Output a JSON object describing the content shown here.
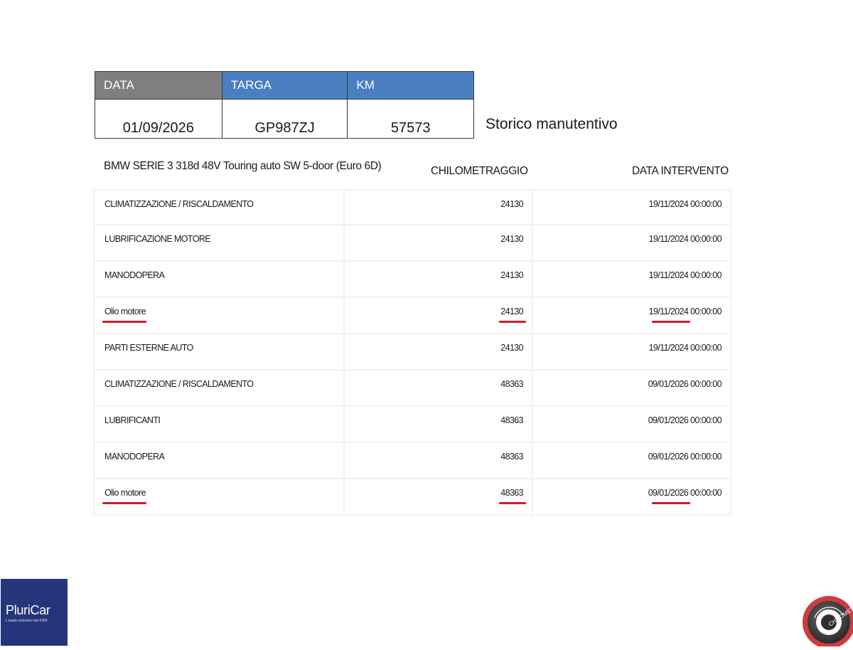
{
  "summary": {
    "headers": [
      "DATA",
      "TARGA",
      "KM"
    ],
    "values": [
      "01/09/2026",
      "GP987ZJ",
      "57573"
    ]
  },
  "document_title": "Storico manutentivo",
  "vehicle": "BMW SERIE 3 318d 48V Touring auto SW 5-door (Euro 6D)",
  "columns": {
    "km": "CHILOMETRAGGIO",
    "date": "DATA INTERVENTO"
  },
  "rows": [
    {
      "desc": "CLIMATIZZAZIONE / RISCALDAMENTO",
      "km": "24130",
      "date": "19/11/2024 00:00:00",
      "highlighted": false
    },
    {
      "desc": "LUBRIFICAZIONE MOTORE",
      "km": "24130",
      "date": "19/11/2024 00:00:00",
      "highlighted": false
    },
    {
      "desc": "MANODOPERA",
      "km": "24130",
      "date": "19/11/2024 00:00:00",
      "highlighted": false
    },
    {
      "desc": "Olio motore",
      "km": "24130",
      "date": "19/11/2024 00:00:00",
      "highlighted": true
    },
    {
      "desc": "PARTI ESTERNE AUTO",
      "km": "24130",
      "date": "19/11/2024 00:00:00",
      "highlighted": false
    },
    {
      "desc": "CLIMATIZZAZIONE / RISCALDAMENTO",
      "km": "48363",
      "date": "09/01/2026 00:00:00",
      "highlighted": false
    },
    {
      "desc": "LUBRIFICANTI",
      "km": "48363",
      "date": "09/01/2026 00:00:00",
      "highlighted": false
    },
    {
      "desc": "MANODOPERA",
      "km": "48363",
      "date": "09/01/2026 00:00:00",
      "highlighted": false
    },
    {
      "desc": "Olio motore",
      "km": "48363",
      "date": "09/01/2026 00:00:00",
      "highlighted": true
    }
  ],
  "colors": {
    "header_gray": "#7f7f7f",
    "header_blue": "#4a7fc1",
    "highlight_red": "#cc1f2e",
    "pluricar_blue": "#24357a"
  },
  "logos": {
    "pluricar": {
      "brand": "PluriCar",
      "tagline": "L'usato esclusivo dal 1999"
    },
    "km_seal": {
      "icon": "km-certified-seal-icon",
      "text": "CHILOMETRO"
    }
  }
}
